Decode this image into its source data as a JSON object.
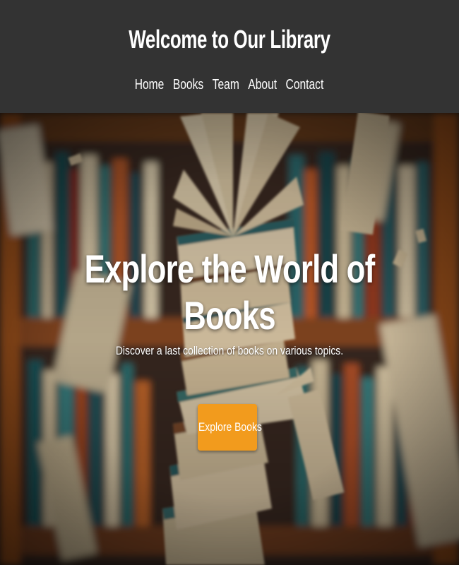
{
  "header": {
    "title": "Welcome to Our Library",
    "nav": [
      {
        "label": "Home"
      },
      {
        "label": "Books"
      },
      {
        "label": "Team"
      },
      {
        "label": "About"
      },
      {
        "label": "Contact"
      }
    ]
  },
  "hero": {
    "title": "Explore the World of Books",
    "subtitle": "Discover a last collection of books on various topics.",
    "cta_label": "Explore Books",
    "background_image": "flying-books-library-photo"
  },
  "colors": {
    "header_bg": "#333333",
    "accent": "#f29b1d",
    "text": "#ffffff"
  }
}
